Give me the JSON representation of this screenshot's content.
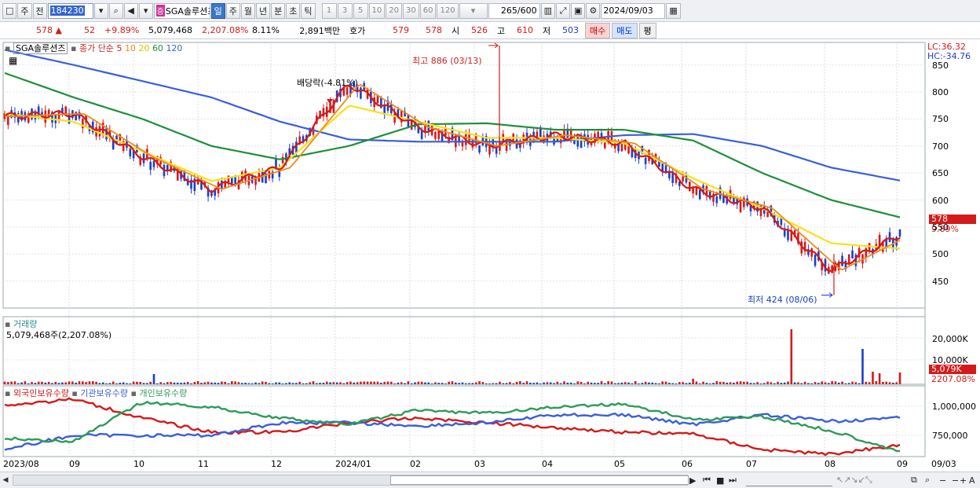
{
  "toolbar": {
    "btn_chart": "□",
    "period_main": "주",
    "btn_prev": "전",
    "stock_code": "184230",
    "stock_tag": "증",
    "stock_name": "SGA솔루션즈",
    "periods": [
      "일",
      "주",
      "월",
      "년",
      "분",
      "초",
      "틱"
    ],
    "active_period": "일",
    "intervals": [
      "1",
      "3",
      "5",
      "10",
      "20",
      "30",
      "60",
      "120"
    ],
    "count": "265",
    "count_total": "/600",
    "date": "2024/09/03"
  },
  "quote": {
    "price": "578",
    "change_arrow": "▲",
    "change": "52",
    "change_pct": "+9.89%",
    "volume": "5,079,468",
    "volume_ratio": "2,207.08%",
    "turnover": "8.11%",
    "amount": "2,891백만",
    "hoga_label": "호가",
    "ask": "579",
    "bid": "578",
    "open_label": "시",
    "open": "526",
    "high_label": "고",
    "high": "610",
    "low_label": "저",
    "low": "503",
    "buy_label": "매수",
    "sell_label": "매도",
    "eval_label": "평"
  },
  "price_panel": {
    "stock_label": "SGA솔루션즈",
    "ma_label": "종가 단순",
    "ma_periods": [
      "5",
      "10",
      "20",
      "60",
      "120"
    ],
    "lc": "LC:36.32",
    "hc": "HC:-34.76",
    "high_ann": "최고 886 (03/13)",
    "low_ann": "최저 424 (08/06)",
    "dividend_ann": "배당락(-4.81%)",
    "price_tag": "578",
    "pct_tag": "9.89%",
    "y_ticks": [
      "850",
      "800",
      "750",
      "700",
      "650",
      "600",
      "550",
      "500",
      "450"
    ]
  },
  "volume_panel": {
    "title": "거래량",
    "value": "5,079,468주(2,207.08%)",
    "y_ticks": [
      "20,000K",
      "10,000K"
    ],
    "tag_value": "5,079K",
    "tag_pct": "2207.08%"
  },
  "holdings_panel": {
    "legend": [
      "외국인보유수량",
      "기관보유수량",
      "개인보유수량"
    ],
    "y_ticks": [
      "1,000,000",
      "750,000"
    ]
  },
  "x_axis": {
    "labels": [
      "2023/08",
      "09",
      "10",
      "11",
      "12",
      "2024/01",
      "02",
      "03",
      "04",
      "05",
      "06",
      "07",
      "08",
      "09"
    ],
    "corner": "09/03"
  },
  "colors": {
    "up": "#d41a1a",
    "down": "#1a3fc8",
    "ma5": "#d41a1a",
    "ma10": "#f08a1c",
    "ma20": "#f5e21a",
    "ma60": "#1f8f3a",
    "ma120": "#3a5fd8",
    "foreign": "#d41a1a",
    "institution": "#3a5fd8",
    "individual": "#2f9a5a"
  },
  "chart_data": {
    "type": "line",
    "ylim": [
      400,
      880
    ],
    "series": [
      {
        "name": "120",
        "x": [
          "2023/08",
          "09",
          "10",
          "11",
          "12",
          "2024/01",
          "02",
          "03",
          "04",
          "05",
          "06",
          "07",
          "08",
          "09"
        ],
        "values": [
          878,
          850,
          820,
          790,
          745,
          712,
          708,
          708,
          708,
          720,
          722,
          700,
          660,
          636
        ]
      },
      {
        "name": "60",
        "x": [
          "2023/08",
          "09",
          "10",
          "11",
          "12",
          "2024/01",
          "02",
          "03",
          "04",
          "05",
          "06",
          "07",
          "08",
          "09"
        ],
        "values": [
          835,
          790,
          750,
          700,
          675,
          700,
          740,
          742,
          730,
          730,
          710,
          650,
          600,
          568
        ]
      },
      {
        "name": "20",
        "x": [
          "2023/08",
          "09",
          "10",
          "11",
          "12",
          "2024/01",
          "02",
          "03",
          "04",
          "05",
          "06",
          "07",
          "08",
          "09"
        ],
        "values": [
          760,
          745,
          690,
          635,
          660,
          775,
          745,
          715,
          715,
          705,
          640,
          585,
          520,
          510
        ]
      },
      {
        "name": "5",
        "x": [
          "2023/08",
          "09",
          "10",
          "11",
          "12",
          "2024/01",
          "02",
          "03",
          "04",
          "05",
          "06",
          "07",
          "08",
          "09"
        ],
        "values": [
          755,
          760,
          680,
          620,
          660,
          815,
          735,
          700,
          720,
          705,
          620,
          585,
          470,
          535
        ]
      }
    ]
  }
}
